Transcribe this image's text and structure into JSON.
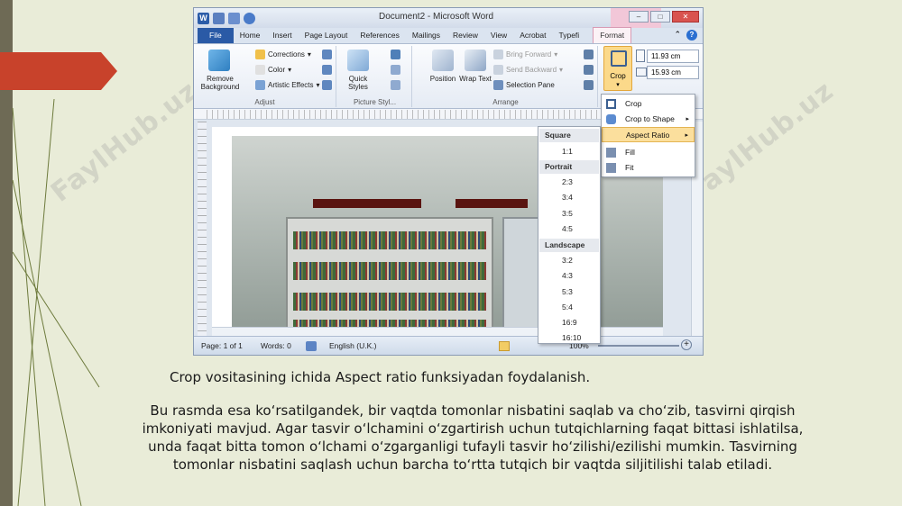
{
  "watermark_text": "FaylHub.uz",
  "word": {
    "title": "Document2 - Microsoft Word",
    "tabs": [
      "File",
      "Home",
      "Insert",
      "Page Layout",
      "References",
      "Mailings",
      "Review",
      "View",
      "Acrobat",
      "Typefi",
      "Format"
    ],
    "ribbon": {
      "remove_background": "Remove Background",
      "corrections": "Corrections",
      "color": "Color",
      "artistic_effects": "Artistic Effects",
      "adjust_label": "Adjust",
      "quick_styles": "Quick Styles",
      "picture_styles_label": "Picture Styl...",
      "position": "Position",
      "wrap_text": "Wrap Text",
      "bring_forward": "Bring Forward",
      "send_backward": "Send Backward",
      "selection_pane": "Selection Pane",
      "arrange_label": "Arrange",
      "crop": "Crop",
      "height_value": "11.93 cm",
      "width_value": "15.93 cm"
    },
    "crop_menu": [
      "Crop",
      "Crop to Shape",
      "Aspect Ratio",
      "Fill",
      "Fit"
    ],
    "aspect_menu": {
      "square_header": "Square",
      "square": [
        "1:1"
      ],
      "portrait_header": "Portrait",
      "portrait": [
        "2:3",
        "3:4",
        "3:5",
        "4:5"
      ],
      "landscape_header": "Landscape",
      "landscape": [
        "3:2",
        "4:3",
        "5:3",
        "5:4",
        "16:9",
        "16:10"
      ]
    },
    "status": {
      "page": "Page: 1 of 1",
      "words": "Words: 0",
      "language": "English (U.K.)",
      "zoom": "100%"
    }
  },
  "caption": "Crop vositasining ichida Aspect ratio funksiyadan foydalanish.",
  "paragraph": "Bu rasmda esa ko‘rsatilgandek, bir vaqtda tomonlar nisbatini saqlab va cho‘zib, tasvirni qirqish imkoniyati mavjud. Agar tasvir o‘lchamini o‘zgartirish uchun tutqichlarning faqat bittasi ishlatilsa, unda faqat bitta tomon o‘lchami o‘zgarganligi tufayli tasvir ho‘zilishi/ezilishi mumkin. Tasvirning tomonlar nisbatini saqlash uchun barcha to‘rtta tutqich bir vaqtda siljitilishi talab etiladi."
}
